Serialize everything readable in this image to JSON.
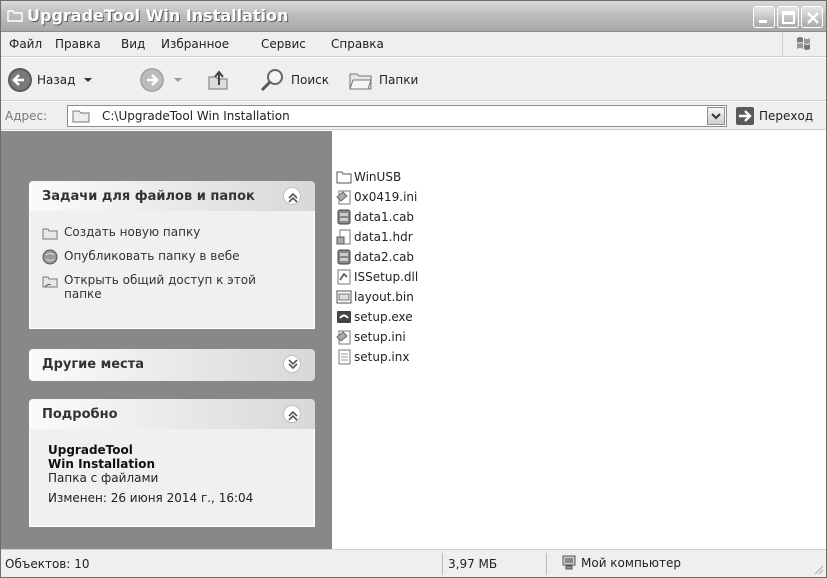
{
  "window": {
    "title": "UpgradeTool Win Installation"
  },
  "menu": [
    "Файл",
    "Правка",
    "Вид",
    "Избранное",
    "Сервис",
    "Справка"
  ],
  "toolbar": {
    "back_label": "Назад",
    "search_label": "Поиск",
    "folders_label": "Папки"
  },
  "address": {
    "label": "Адрес:",
    "value": "C:\\UpgradeTool Win Installation",
    "go_label": "Переход"
  },
  "tasks_panel": {
    "title": "Задачи для файлов и папок",
    "items": [
      {
        "label": "Создать новую папку",
        "icon": "new-folder-icon"
      },
      {
        "label": "Опубликовать папку в вебе",
        "icon": "publish-web-icon"
      },
      {
        "label": "Открыть общий доступ к этой папке",
        "icon": "share-folder-icon"
      }
    ]
  },
  "other_places_panel": {
    "title": "Другие места"
  },
  "details_panel": {
    "title": "Подробно",
    "name_line1": "UpgradeTool",
    "name_line2": "Win Installation",
    "type": "Папка с файлами",
    "modified": "Изменен: 26 июня 2014 г., 16:04"
  },
  "files": [
    {
      "name": "WinUSB",
      "icon": "folder-icon"
    },
    {
      "name": "0x0419.ini",
      "icon": "ini-file-icon"
    },
    {
      "name": "data1.cab",
      "icon": "cab-file-icon"
    },
    {
      "name": "data1.hdr",
      "icon": "hdr-file-icon"
    },
    {
      "name": "data2.cab",
      "icon": "cab-file-icon"
    },
    {
      "name": "ISSetup.dll",
      "icon": "dll-file-icon"
    },
    {
      "name": "layout.bin",
      "icon": "bin-file-icon"
    },
    {
      "name": "setup.exe",
      "icon": "exe-file-icon"
    },
    {
      "name": "setup.ini",
      "icon": "ini-file-icon"
    },
    {
      "name": "setup.inx",
      "icon": "inx-file-icon"
    }
  ],
  "status": {
    "objects": "Объектов: 10",
    "size": "3,97 МБ",
    "location": "Мой компьютер"
  }
}
